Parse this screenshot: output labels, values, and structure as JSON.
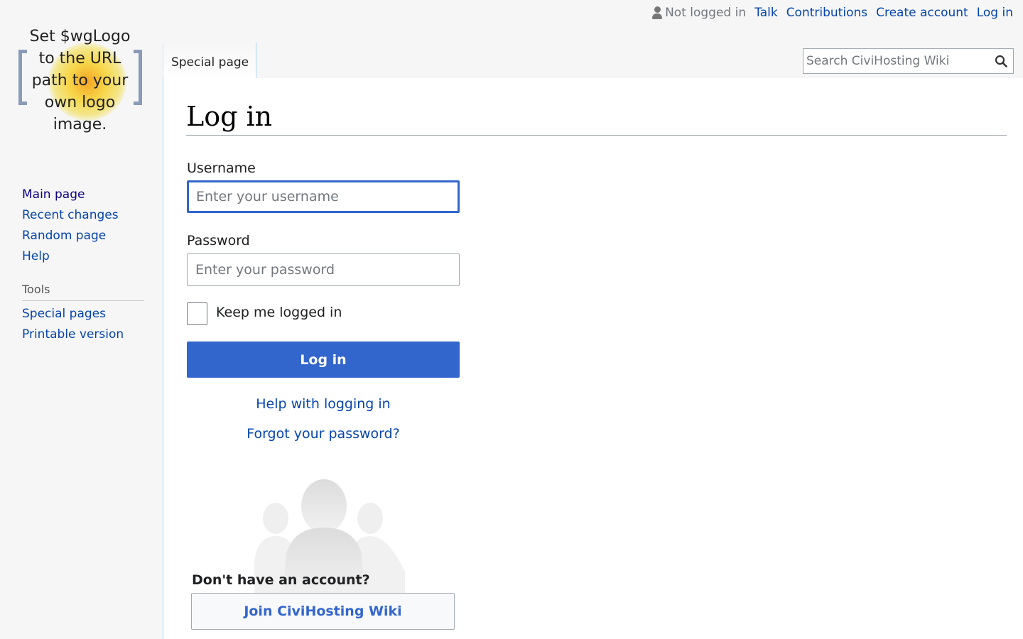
{
  "logo": {
    "text": "Set $wgLogo\nto the URL\npath to your\nown logo\nimage."
  },
  "sidebar": {
    "navigation": [
      {
        "label": "Main page",
        "visited": true
      },
      {
        "label": "Recent changes",
        "visited": false
      },
      {
        "label": "Random page",
        "visited": false
      },
      {
        "label": "Help",
        "visited": false
      }
    ],
    "tools_heading": "Tools",
    "tools": [
      {
        "label": "Special pages"
      },
      {
        "label": "Printable version"
      }
    ]
  },
  "personal": {
    "not_logged_in": "Not logged in",
    "links": [
      "Talk",
      "Contributions",
      "Create account",
      "Log in"
    ]
  },
  "tabs": {
    "special_page": "Special page"
  },
  "search": {
    "placeholder": "Search CiviHosting Wiki",
    "icon": "search-icon"
  },
  "main": {
    "title": "Log in",
    "username_label": "Username",
    "username_placeholder": "Enter your username",
    "password_label": "Password",
    "password_placeholder": "Enter your password",
    "remember_label": "Keep me logged in",
    "remember_checked": false,
    "login_button": "Log in",
    "help_link": "Help with logging in",
    "forgot_link": "Forgot your password?",
    "no_account": "Don't have an account?",
    "join_button": "Join CiviHosting Wiki"
  },
  "colors": {
    "link": "#0645ad",
    "link_visited": "#0b0080",
    "primary": "#3366cc",
    "border": "#a7d7f9"
  }
}
